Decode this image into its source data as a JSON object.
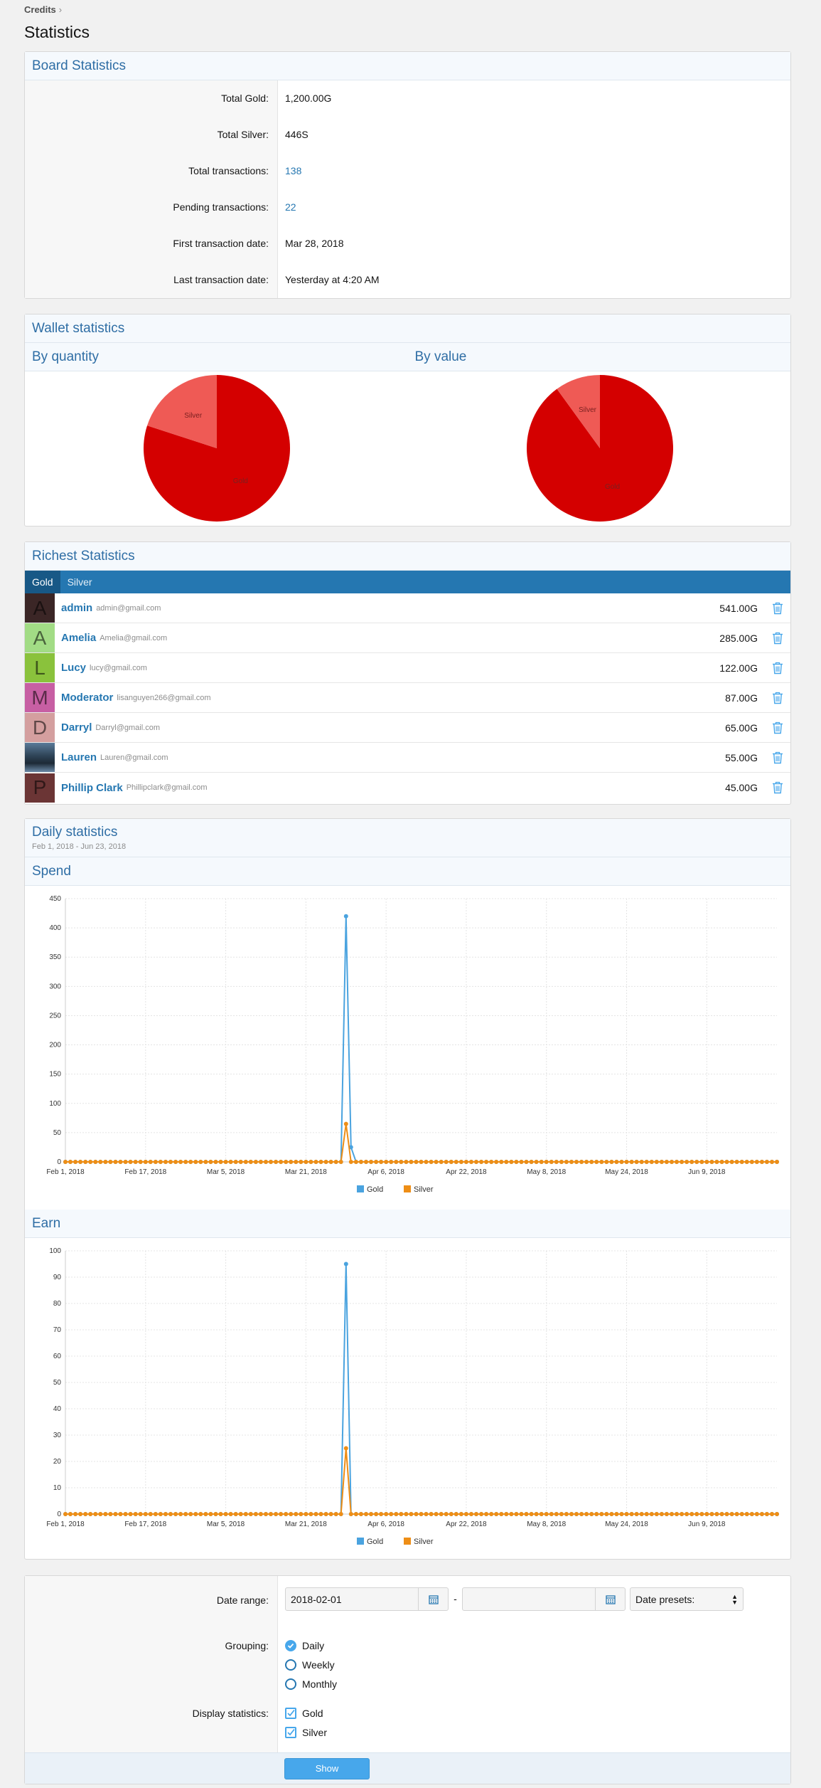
{
  "breadcrumb": {
    "item": "Credits",
    "sep": "›"
  },
  "page_title": "Statistics",
  "board": {
    "title": "Board Statistics",
    "rows": [
      {
        "label": "Total Gold:",
        "value": "1,200.00G",
        "link": false
      },
      {
        "label": "Total Silver:",
        "value": "446S",
        "link": false
      },
      {
        "label": "Total transactions:",
        "value": "138",
        "link": true
      },
      {
        "label": "Pending transactions:",
        "value": "22",
        "link": true
      },
      {
        "label": "First transaction date:",
        "value": "Mar 28, 2018",
        "link": false
      },
      {
        "label": "Last transaction date:",
        "value": "Yesterday at 4:20 AM",
        "link": false
      }
    ]
  },
  "wallet": {
    "title": "Wallet statistics",
    "by_quantity": "By quantity",
    "by_value": "By value",
    "colors": {
      "gold": "#d40000",
      "silver": "#ef5a55"
    }
  },
  "richest": {
    "title": "Richest Statistics",
    "tabs": [
      "Gold",
      "Silver"
    ],
    "users": [
      {
        "initial": "A",
        "name": "admin",
        "email": "admin@gmail.com",
        "amount": "541.00G",
        "color": "#3b2626"
      },
      {
        "initial": "A",
        "name": "Amelia",
        "email": "Amelia@gmail.com",
        "amount": "285.00G",
        "color": "#a2dc85"
      },
      {
        "initial": "L",
        "name": "Lucy",
        "email": "lucy@gmail.com",
        "amount": "122.00G",
        "color": "#8ac23c"
      },
      {
        "initial": "M",
        "name": "Moderator",
        "email": "lisanguyen266@gmail.com",
        "amount": "87.00G",
        "color": "#c75fa3"
      },
      {
        "initial": "D",
        "name": "Darryl",
        "email": "Darryl@gmail.com",
        "amount": "65.00G",
        "color": "#d49f9f"
      },
      {
        "initial": "",
        "name": "Lauren",
        "email": "Lauren@gmail.com",
        "amount": "55.00G",
        "color": "#35495e"
      },
      {
        "initial": "P",
        "name": "Phillip Clark",
        "email": "Phillipclark@gmail.com",
        "amount": "45.00G",
        "color": "#6b3535"
      }
    ]
  },
  "daily": {
    "title": "Daily statistics",
    "range": "Feb 1, 2018 - Jun 23, 2018"
  },
  "chart_data": [
    {
      "type": "pie",
      "title": "By quantity",
      "categories": [
        "Gold",
        "Silver"
      ],
      "values": [
        80,
        20
      ]
    },
    {
      "type": "pie",
      "title": "By value",
      "categories": [
        "Gold",
        "Silver"
      ],
      "values": [
        90,
        10
      ]
    },
    {
      "type": "line",
      "title": "Spend",
      "x_ticks": [
        "Feb 1, 2018",
        "Feb 17, 2018",
        "Mar 5, 2018",
        "Mar 21, 2018",
        "Apr 6, 2018",
        "Apr 22, 2018",
        "May 8, 2018",
        "May 24, 2018",
        "Jun 9, 2018"
      ],
      "x_range": [
        "2018-02-01",
        "2018-06-23"
      ],
      "ylim": [
        0,
        450
      ],
      "yticks": [
        0,
        50,
        100,
        150,
        200,
        250,
        300,
        350,
        400,
        450
      ],
      "series": [
        {
          "name": "Gold",
          "color": "#4aa3df",
          "points": [
            [
              "2018-03-29",
              420
            ],
            [
              "2018-03-30",
              25
            ]
          ]
        },
        {
          "name": "Silver",
          "color": "#ee8e16",
          "points": [
            [
              "2018-03-29",
              65
            ]
          ]
        }
      ],
      "grid": true,
      "legend": "bottom"
    },
    {
      "type": "line",
      "title": "Earn",
      "x_ticks": [
        "Feb 1, 2018",
        "Feb 17, 2018",
        "Mar 5, 2018",
        "Mar 21, 2018",
        "Apr 6, 2018",
        "Apr 22, 2018",
        "May 8, 2018",
        "May 24, 2018",
        "Jun 9, 2018"
      ],
      "x_range": [
        "2018-02-01",
        "2018-06-23"
      ],
      "ylim": [
        0,
        100
      ],
      "yticks": [
        0,
        10,
        20,
        30,
        40,
        50,
        60,
        70,
        80,
        90,
        100
      ],
      "series": [
        {
          "name": "Gold",
          "color": "#4aa3df",
          "points": [
            [
              "2018-03-29",
              95
            ]
          ]
        },
        {
          "name": "Silver",
          "color": "#ee8e16",
          "points": [
            [
              "2018-03-29",
              25
            ]
          ]
        }
      ],
      "grid": true,
      "legend": "bottom"
    }
  ],
  "form": {
    "date_range_label": "Date range:",
    "start_date": "2018-02-01",
    "end_date": "",
    "dash": "-",
    "presets": "Date presets:",
    "grouping_label": "Grouping:",
    "grouping": [
      "Daily",
      "Weekly",
      "Monthly"
    ],
    "display_label": "Display statistics:",
    "display": [
      "Gold",
      "Silver"
    ],
    "show_button": "Show"
  }
}
